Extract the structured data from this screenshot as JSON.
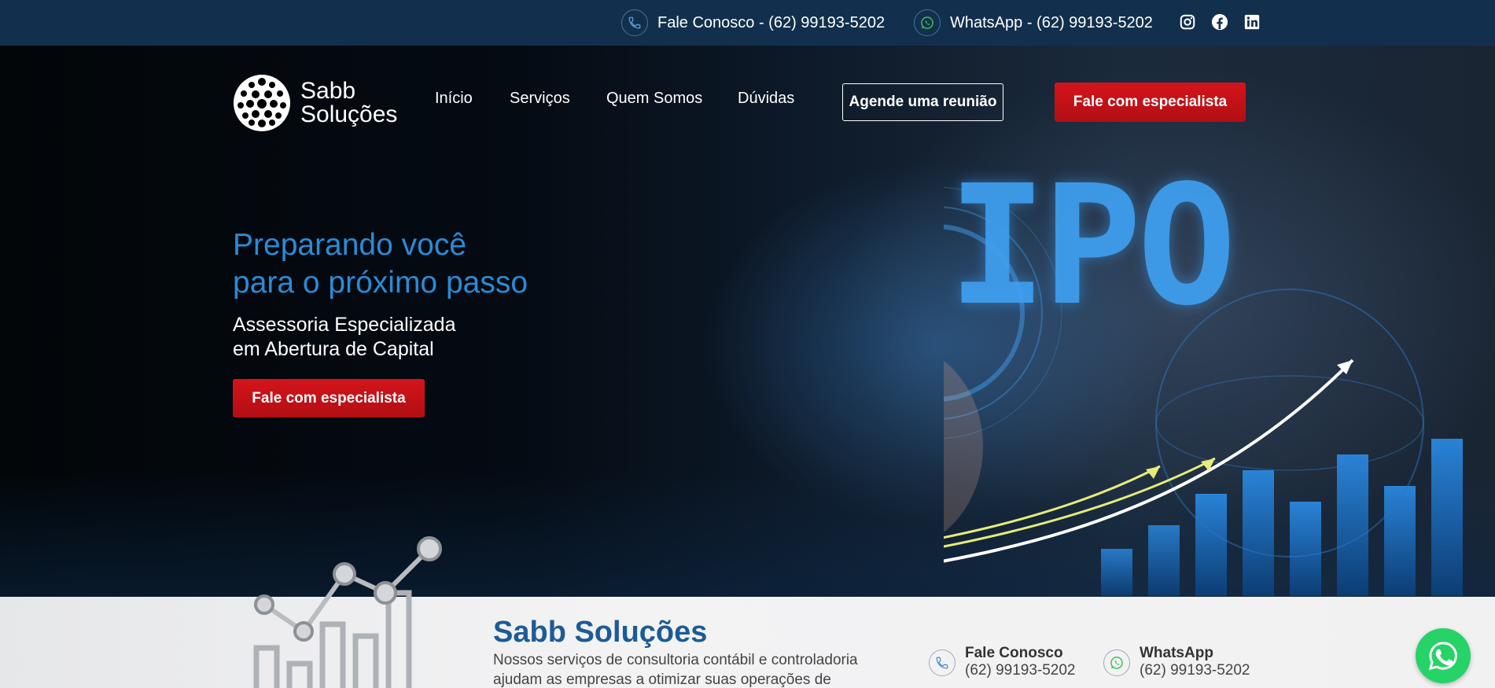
{
  "topbar": {
    "phone_text": "Fale Conosco - (62) 99193-5202",
    "whatsapp_text": "WhatsApp - (62) 99193-5202",
    "social": [
      "instagram-icon",
      "facebook-icon",
      "linkedin-icon"
    ]
  },
  "header": {
    "logo_line1": "Sabb",
    "logo_line2": "Soluções",
    "nav": [
      "Início",
      "Serviços",
      "Quem Somos",
      "Dúvidas"
    ],
    "cta_outline": "Agende uma reunião",
    "cta_red": "Fale com especialista"
  },
  "hero": {
    "headline_line1": "Preparando você",
    "headline_line2": "para o próximo passo",
    "subhead_line1": "Assessoria Especializada",
    "subhead_line2": "em Abertura de Capital",
    "cta": "Fale com especialista",
    "image_text": "IPO"
  },
  "about": {
    "title": "Sabb Soluções",
    "description": "Nossos serviços de consultoria contábil e controladoria ajudam as empresas a otimizar suas operações de",
    "contact_phone_label": "Fale Conosco",
    "contact_phone_number": "(62) 99193-5202",
    "contact_whats_label": "WhatsApp",
    "contact_whats_number": "(62) 99193-5202"
  },
  "colors": {
    "topbar_bg": "#12304d",
    "accent_blue": "#2a8bd6",
    "cta_red": "#c8141a",
    "title_blue": "#1d5b95",
    "whatsapp_green": "#25d366"
  }
}
